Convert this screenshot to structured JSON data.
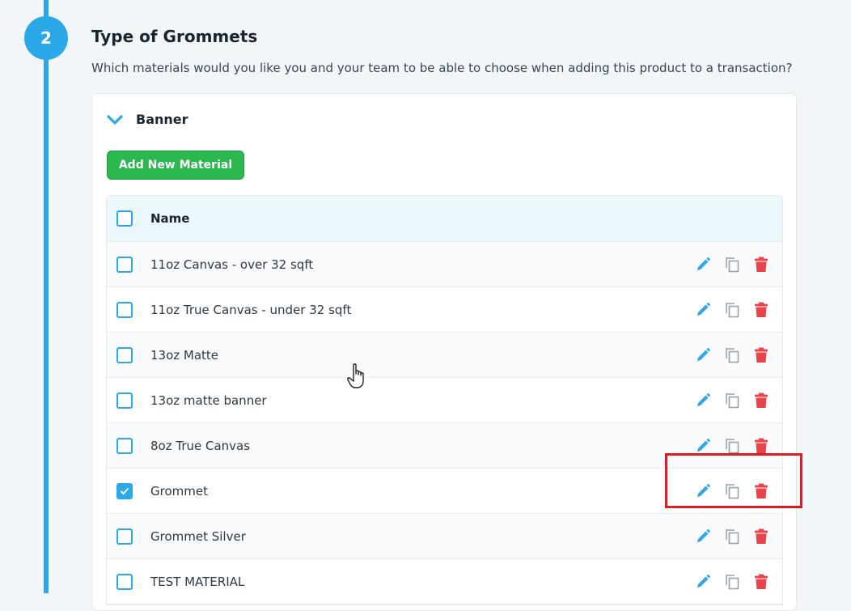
{
  "step": {
    "number": "2"
  },
  "section": {
    "title": "Type of Grommets",
    "subtitle": "Which materials would you like you and your team to be able to choose when adding this product to a transaction?"
  },
  "group": {
    "title": "Banner",
    "add_button": "Add New Material"
  },
  "table": {
    "header": "Name",
    "rows": [
      {
        "name": "11oz Canvas - over 32 sqft",
        "checked": false
      },
      {
        "name": "11oz True Canvas - under 32 sqft",
        "checked": false
      },
      {
        "name": "13oz Matte",
        "checked": false
      },
      {
        "name": "13oz matte banner",
        "checked": false
      },
      {
        "name": "8oz True Canvas",
        "checked": false
      },
      {
        "name": "Grommet",
        "checked": true
      },
      {
        "name": "Grommet Silver",
        "checked": false
      },
      {
        "name": "TEST MATERIAL",
        "checked": false
      }
    ]
  },
  "icons": {
    "edit": "pencil-icon",
    "copy": "copy-icon",
    "delete": "trash-icon",
    "cursor": "hand-pointer-cursor"
  },
  "colors": {
    "accent": "#2aa8e8",
    "add_button": "#2ab84f",
    "delete": "#e8424a",
    "annotation": "#e01b24"
  }
}
